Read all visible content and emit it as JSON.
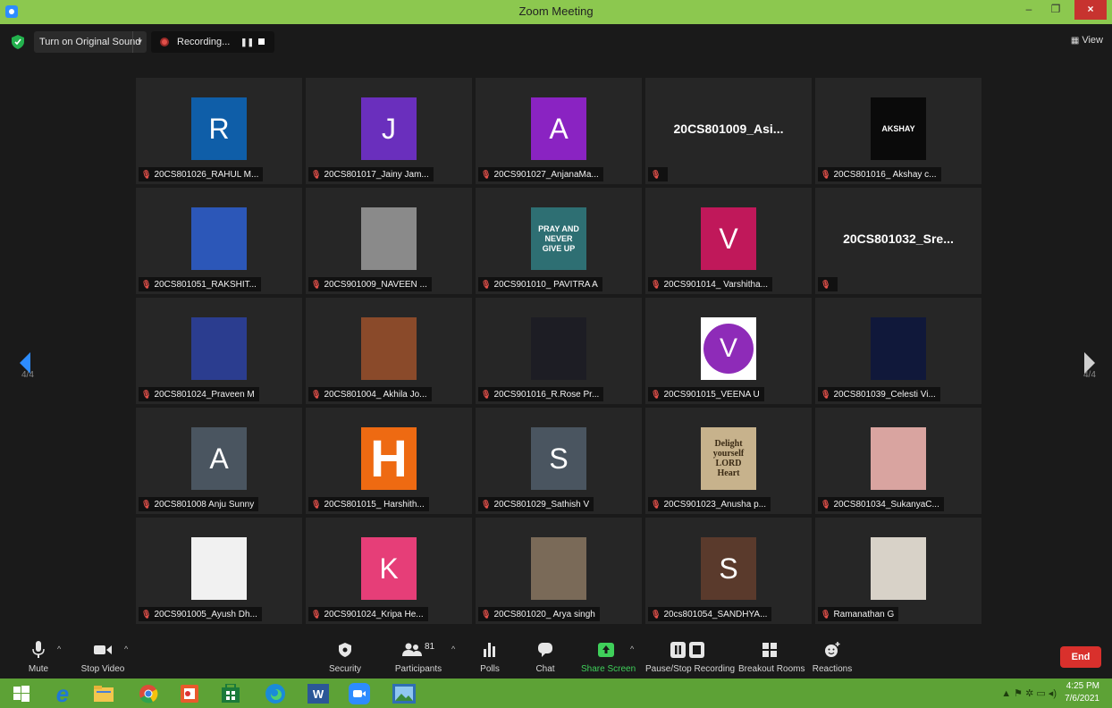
{
  "window": {
    "title": "Zoom Meeting",
    "minimize": "–",
    "restore": "❐",
    "close": "×"
  },
  "topbar": {
    "original_sound": "Turn on Original Sound",
    "recording": "Recording...",
    "pause_glyph": "❚❚",
    "view": "View"
  },
  "page_indicator": {
    "left": "4/4",
    "right": "4/4"
  },
  "participants": [
    {
      "name": "20CS801026_RAHUL M...",
      "avatar_type": "letter",
      "avatar": "R",
      "color": "#0f5ea8"
    },
    {
      "name": "20CS801017_Jainy Jam...",
      "avatar_type": "letter",
      "avatar": "J",
      "color": "#6a2fbd"
    },
    {
      "name": "20CS901027_AnjanaMa...",
      "avatar_type": "letter",
      "avatar": "A",
      "color": "#8a23c2"
    },
    {
      "name": "",
      "avatar_type": "name",
      "avatar": "20CS801009_Asi...",
      "color": ""
    },
    {
      "name": "20CS801016_ Akshay c...",
      "avatar_type": "photo",
      "avatar": "AKSHAY",
      "color": "#0a0a0a"
    },
    {
      "name": "20CS801051_RAKSHIT...",
      "avatar_type": "photo",
      "avatar": "",
      "color": "#2c57b8"
    },
    {
      "name": "20CS901009_NAVEEN ...",
      "avatar_type": "photo",
      "avatar": "",
      "color": "#8a8a8a"
    },
    {
      "name": "20CS901010_ PAVITRA A",
      "avatar_type": "photo",
      "avatar": "PRAY AND NEVER GIVE UP",
      "color": "#2e6f73"
    },
    {
      "name": "20CS901014_ Varshitha...",
      "avatar_type": "letter",
      "avatar": "V",
      "color": "#c0185a"
    },
    {
      "name": "",
      "avatar_type": "name",
      "avatar": "20CS801032_Sre...",
      "color": ""
    },
    {
      "name": "20CS801024_Praveen M",
      "avatar_type": "photo",
      "avatar": "",
      "color": "#2b3d8f"
    },
    {
      "name": "20CS801004_ Akhila Jo...",
      "avatar_type": "photo",
      "avatar": "",
      "color": "#8a4a2a"
    },
    {
      "name": "20CS901016_R.Rose Pr...",
      "avatar_type": "photo",
      "avatar": "",
      "color": "#1d1d24"
    },
    {
      "name": "20CS901015_VEENA U",
      "avatar_type": "letter-circle",
      "avatar": "V",
      "color": "#8e2bb8"
    },
    {
      "name": "20CS801039_Celesti Vi...",
      "avatar_type": "photo",
      "avatar": "",
      "color": "#10183a"
    },
    {
      "name": "20CS801008 Anju Sunny",
      "avatar_type": "letter",
      "avatar": "A",
      "color": "#4a5560"
    },
    {
      "name": "20CS801015_ Harshith...",
      "avatar_type": "photo",
      "avatar": "H",
      "color": "#ee6a12"
    },
    {
      "name": "20CS801029_Sathish V",
      "avatar_type": "letter",
      "avatar": "S",
      "color": "#4a5560"
    },
    {
      "name": "20CS901023_Anusha p...",
      "avatar_type": "photo",
      "avatar": "Delight yourself LORD Heart",
      "color": "#c7b28c"
    },
    {
      "name": "20CS801034_SukanyaC...",
      "avatar_type": "photo",
      "avatar": "",
      "color": "#d9a4a0"
    },
    {
      "name": "20CS901005_Ayush Dh...",
      "avatar_type": "photo",
      "avatar": "",
      "color": "#f1f1f1"
    },
    {
      "name": "20CS901024_Kripa He...",
      "avatar_type": "letter",
      "avatar": "K",
      "color": "#e63e78"
    },
    {
      "name": "20CS801020_ Arya singh",
      "avatar_type": "photo",
      "avatar": "",
      "color": "#7a6a58"
    },
    {
      "name": "20cs801054_SANDHYA...",
      "avatar_type": "letter",
      "avatar": "S",
      "color": "#5a3a2c"
    },
    {
      "name": "Ramanathan G",
      "avatar_type": "photo",
      "avatar": "",
      "color": "#d8d2c8"
    }
  ],
  "toolbar": {
    "mute": "Mute",
    "stop_video": "Stop Video",
    "security": "Security",
    "participants": "Participants",
    "participants_count": "81",
    "polls": "Polls",
    "chat": "Chat",
    "share_screen": "Share Screen",
    "pause_recording": "Pause/Stop Recording",
    "breakout_rooms": "Breakout Rooms",
    "reactions": "Reactions",
    "end": "End"
  },
  "taskbar": {
    "time": "4:25 PM",
    "date": "7/6/2021",
    "apps": [
      "start-icon",
      "internet-explorer-icon",
      "file-explorer-icon",
      "chrome-icon",
      "paint-icon",
      "store-icon",
      "edge-icon",
      "word-icon",
      "zoom-icon",
      "photos-icon"
    ]
  },
  "colors": {
    "titlebar": "#8cc84f",
    "taskbar": "#5da236",
    "end_button": "#d9302c",
    "share_green": "#3fcf5a"
  }
}
